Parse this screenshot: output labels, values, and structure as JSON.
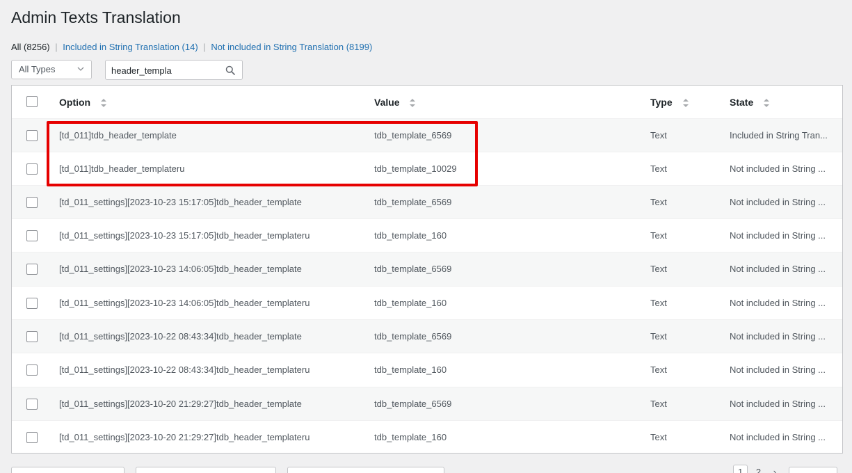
{
  "title": "Admin Texts Translation",
  "filters": {
    "all": "All (8256)",
    "included": "Included in String Translation (14)",
    "not_included": "Not included in String Translation (8199)",
    "separator": "|"
  },
  "type_select": {
    "value": "All Types"
  },
  "search": {
    "value": "header_templa"
  },
  "table": {
    "headers": {
      "option": "Option",
      "value": "Value",
      "type": "Type",
      "state": "State"
    },
    "rows": [
      {
        "option": "[td_011]tdb_header_template",
        "value": "tdb_template_6569",
        "type": "Text",
        "state": "Included in String Tran..."
      },
      {
        "option": "[td_011]tdb_header_templateru",
        "value": "tdb_template_10029",
        "type": "Text",
        "state": "Not included in String ..."
      },
      {
        "option": "[td_011_settings][2023-10-23 15:17:05]tdb_header_template",
        "value": "tdb_template_6569",
        "type": "Text",
        "state": "Not included in String ..."
      },
      {
        "option": "[td_011_settings][2023-10-23 15:17:05]tdb_header_templateru",
        "value": "tdb_template_160",
        "type": "Text",
        "state": "Not included in String ..."
      },
      {
        "option": "[td_011_settings][2023-10-23 14:06:05]tdb_header_template",
        "value": "tdb_template_6569",
        "type": "Text",
        "state": "Not included in String ..."
      },
      {
        "option": "[td_011_settings][2023-10-23 14:06:05]tdb_header_templateru",
        "value": "tdb_template_160",
        "type": "Text",
        "state": "Not included in String ..."
      },
      {
        "option": "[td_011_settings][2023-10-22 08:43:34]tdb_header_template",
        "value": "tdb_template_6569",
        "type": "Text",
        "state": "Not included in String ..."
      },
      {
        "option": "[td_011_settings][2023-10-22 08:43:34]tdb_header_templateru",
        "value": "tdb_template_160",
        "type": "Text",
        "state": "Not included in String ..."
      },
      {
        "option": "[td_011_settings][2023-10-20 21:29:27]tdb_header_template",
        "value": "tdb_template_6569",
        "type": "Text",
        "state": "Not included in String ..."
      },
      {
        "option": "[td_011_settings][2023-10-20 21:29:27]tdb_header_templateru",
        "value": "tdb_template_160",
        "type": "Text",
        "state": "Not included in String ..."
      }
    ]
  },
  "pagination": {
    "page1": "1",
    "page2": "2",
    "next": "›"
  },
  "colors": {
    "link": "#2271b1",
    "highlight": "#e60000",
    "border": "#c3c4c7"
  },
  "icons": {
    "select": "chevron-down-icon",
    "search": "search-icon",
    "sort": "sort-arrows-icon"
  }
}
